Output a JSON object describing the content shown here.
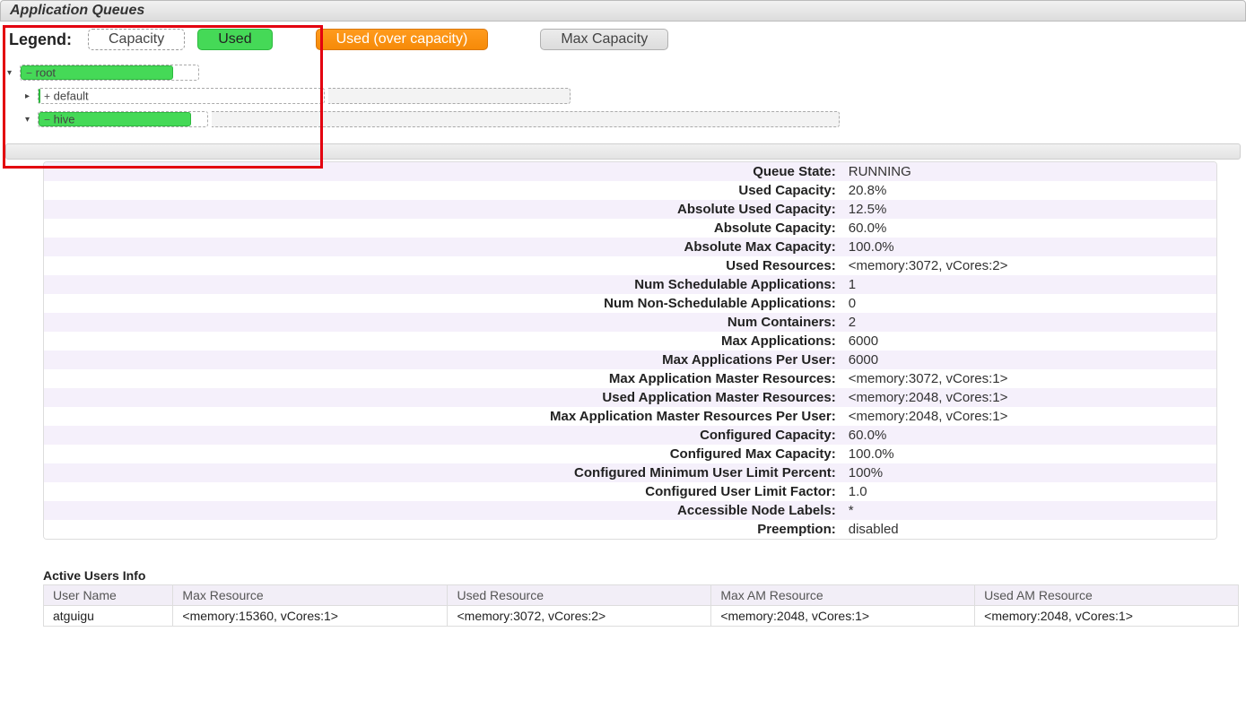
{
  "header": {
    "title": "Application Queues"
  },
  "legend": {
    "label": "Legend:",
    "capacity": "Capacity",
    "used": "Used",
    "used_over": "Used (over capacity)",
    "max": "Max Capacity"
  },
  "tree": {
    "root": {
      "name": "root",
      "icon": "−"
    },
    "default": {
      "name": "default",
      "icon": "+"
    },
    "hive": {
      "name": "hive",
      "icon": "−"
    }
  },
  "details": [
    {
      "k": "Queue State:",
      "v": "RUNNING"
    },
    {
      "k": "Used Capacity:",
      "v": "20.8%"
    },
    {
      "k": "Absolute Used Capacity:",
      "v": "12.5%"
    },
    {
      "k": "Absolute Capacity:",
      "v": "60.0%"
    },
    {
      "k": "Absolute Max Capacity:",
      "v": "100.0%"
    },
    {
      "k": "Used Resources:",
      "v": "<memory:3072, vCores:2>"
    },
    {
      "k": "Num Schedulable Applications:",
      "v": "1"
    },
    {
      "k": "Num Non-Schedulable Applications:",
      "v": "0"
    },
    {
      "k": "Num Containers:",
      "v": "2"
    },
    {
      "k": "Max Applications:",
      "v": "6000"
    },
    {
      "k": "Max Applications Per User:",
      "v": "6000"
    },
    {
      "k": "Max Application Master Resources:",
      "v": "<memory:3072, vCores:1>"
    },
    {
      "k": "Used Application Master Resources:",
      "v": "<memory:2048, vCores:1>"
    },
    {
      "k": "Max Application Master Resources Per User:",
      "v": "<memory:2048, vCores:1>"
    },
    {
      "k": "Configured Capacity:",
      "v": "60.0%"
    },
    {
      "k": "Configured Max Capacity:",
      "v": "100.0%"
    },
    {
      "k": "Configured Minimum User Limit Percent:",
      "v": "100%"
    },
    {
      "k": "Configured User Limit Factor:",
      "v": "1.0"
    },
    {
      "k": "Accessible Node Labels:",
      "v": "*"
    },
    {
      "k": "Preemption:",
      "v": "disabled"
    }
  ],
  "active_users": {
    "title": "Active Users Info",
    "headers": [
      "User Name",
      "Max Resource",
      "Used Resource",
      "Max AM Resource",
      "Used AM Resource"
    ],
    "rows": [
      [
        "atguigu",
        "<memory:15360, vCores:1>",
        "<memory:3072, vCores:2>",
        "<memory:2048, vCores:1>",
        "<memory:2048, vCores:1>"
      ]
    ]
  }
}
